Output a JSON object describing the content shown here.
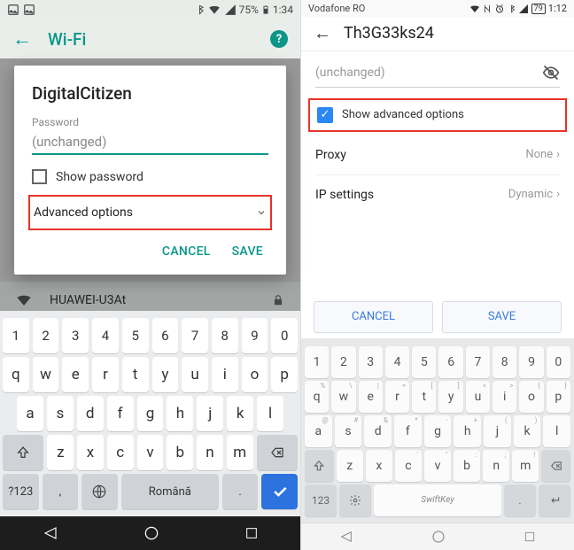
{
  "left": {
    "status": {
      "battery_pct": "75%",
      "time": "1:34"
    },
    "header": {
      "title": "Wi-Fi"
    },
    "dialog": {
      "ssid": "DigitalCitizen",
      "password_label": "Password",
      "password_value": "(unchanged)",
      "show_password": "Show password",
      "advanced": "Advanced options",
      "cancel": "CANCEL",
      "save": "SAVE"
    },
    "bg_network": "HUAWEI-U3At",
    "keyboard": {
      "row1": [
        "1",
        "2",
        "3",
        "4",
        "5",
        "6",
        "7",
        "8",
        "9",
        "0"
      ],
      "row2": [
        "q",
        "w",
        "e",
        "r",
        "t",
        "y",
        "u",
        "i",
        "o",
        "p"
      ],
      "row3": [
        "a",
        "s",
        "d",
        "f",
        "g",
        "h",
        "j",
        "k",
        "l"
      ],
      "row4": [
        "z",
        "x",
        "c",
        "v",
        "b",
        "n",
        "m"
      ],
      "sym": "?123",
      "space": "Română"
    }
  },
  "right": {
    "status": {
      "carrier": "Vodafone RO",
      "battery_pct": "79",
      "time": "1:12"
    },
    "header": {
      "title": "Th3G33ks24"
    },
    "password_value": "(unchanged)",
    "show_advanced": "Show advanced options",
    "proxy": {
      "label": "Proxy",
      "value": "None"
    },
    "ip": {
      "label": "IP settings",
      "value": "Dynamic"
    },
    "cancel": "CANCEL",
    "save": "SAVE",
    "keyboard": {
      "row1": [
        "1",
        "2",
        "3",
        "4",
        "5",
        "6",
        "7",
        "8",
        "9",
        "0"
      ],
      "row2": [
        "q",
        "w",
        "e",
        "r",
        "t",
        "y",
        "u",
        "i",
        "o",
        "p"
      ],
      "row3": [
        "a",
        "s",
        "d",
        "f",
        "g",
        "h",
        "j",
        "k",
        "l"
      ],
      "row4": [
        "z",
        "x",
        "c",
        "v",
        "b",
        "n",
        "m"
      ],
      "sym": "123",
      "space": "SwiftKey"
    }
  }
}
